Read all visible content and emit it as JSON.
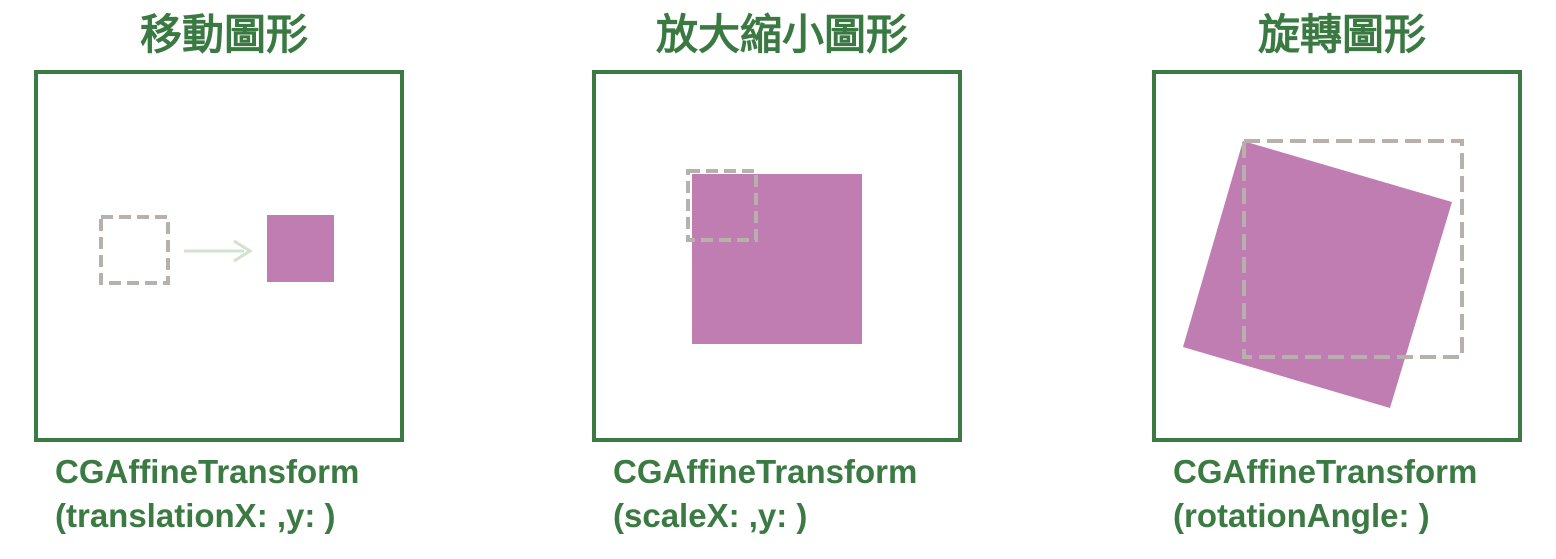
{
  "colors": {
    "frame_border": "#3b7a42",
    "title_text": "#3a7a42",
    "caption_text": "#3b7a42",
    "shape_fill": "#bf7db2",
    "outline_dash": "#b8b0ac",
    "arrow": "#cfe3cf"
  },
  "panels": [
    {
      "title": "移動圖形",
      "caption_line1": "CGAffineTransform",
      "caption_line2": "(translationX: ,y: )"
    },
    {
      "title": "放大縮小圖形",
      "caption_line1": "CGAffineTransform",
      "caption_line2": "(scaleX: ,y: )"
    },
    {
      "title": "旋轉圖形",
      "caption_line1": "CGAffineTransform",
      "caption_line2": "(rotationAngle: )"
    }
  ]
}
